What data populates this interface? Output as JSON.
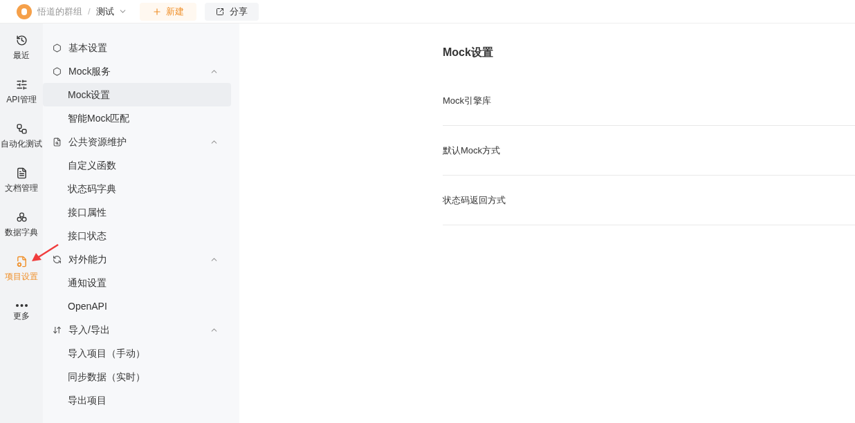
{
  "topbar": {
    "team": "悟道的群组",
    "separator": "/",
    "project": "测试",
    "new_button": "新建",
    "share_button": "分享"
  },
  "rail": [
    {
      "label": "最近",
      "selected": false
    },
    {
      "label": "API管理",
      "selected": false
    },
    {
      "label": "自动化测试",
      "selected": false
    },
    {
      "label": "文档管理",
      "selected": false
    },
    {
      "label": "数据字典",
      "selected": false
    },
    {
      "label": "项目设置",
      "selected": true
    },
    {
      "label": "更多",
      "selected": false
    }
  ],
  "settings_menu": [
    {
      "kind": "item",
      "label": "基本设置",
      "selected": false
    },
    {
      "kind": "group",
      "label": "Mock服务",
      "expanded": true,
      "children": [
        {
          "label": "Mock设置",
          "selected": true
        },
        {
          "label": "智能Mock匹配",
          "selected": false
        }
      ]
    },
    {
      "kind": "group",
      "label": "公共资源维护",
      "expanded": true,
      "children": [
        {
          "label": "自定义函数",
          "selected": false
        },
        {
          "label": "状态码字典",
          "selected": false
        },
        {
          "label": "接口属性",
          "selected": false
        },
        {
          "label": "接口状态",
          "selected": false
        }
      ]
    },
    {
      "kind": "group",
      "label": "对外能力",
      "expanded": true,
      "children": [
        {
          "label": "通知设置",
          "selected": false
        },
        {
          "label": "OpenAPI",
          "selected": false
        }
      ]
    },
    {
      "kind": "group",
      "label": "导入/导出",
      "expanded": true,
      "children": [
        {
          "label": "导入项目（手动）",
          "selected": false
        },
        {
          "label": "同步数据（实时）",
          "selected": false
        },
        {
          "label": "导出项目",
          "selected": false
        }
      ]
    }
  ],
  "main": {
    "title": "Mock设置",
    "rows": [
      "Mock引擎库",
      "默认Mock方式",
      "状态码返回方式"
    ]
  }
}
